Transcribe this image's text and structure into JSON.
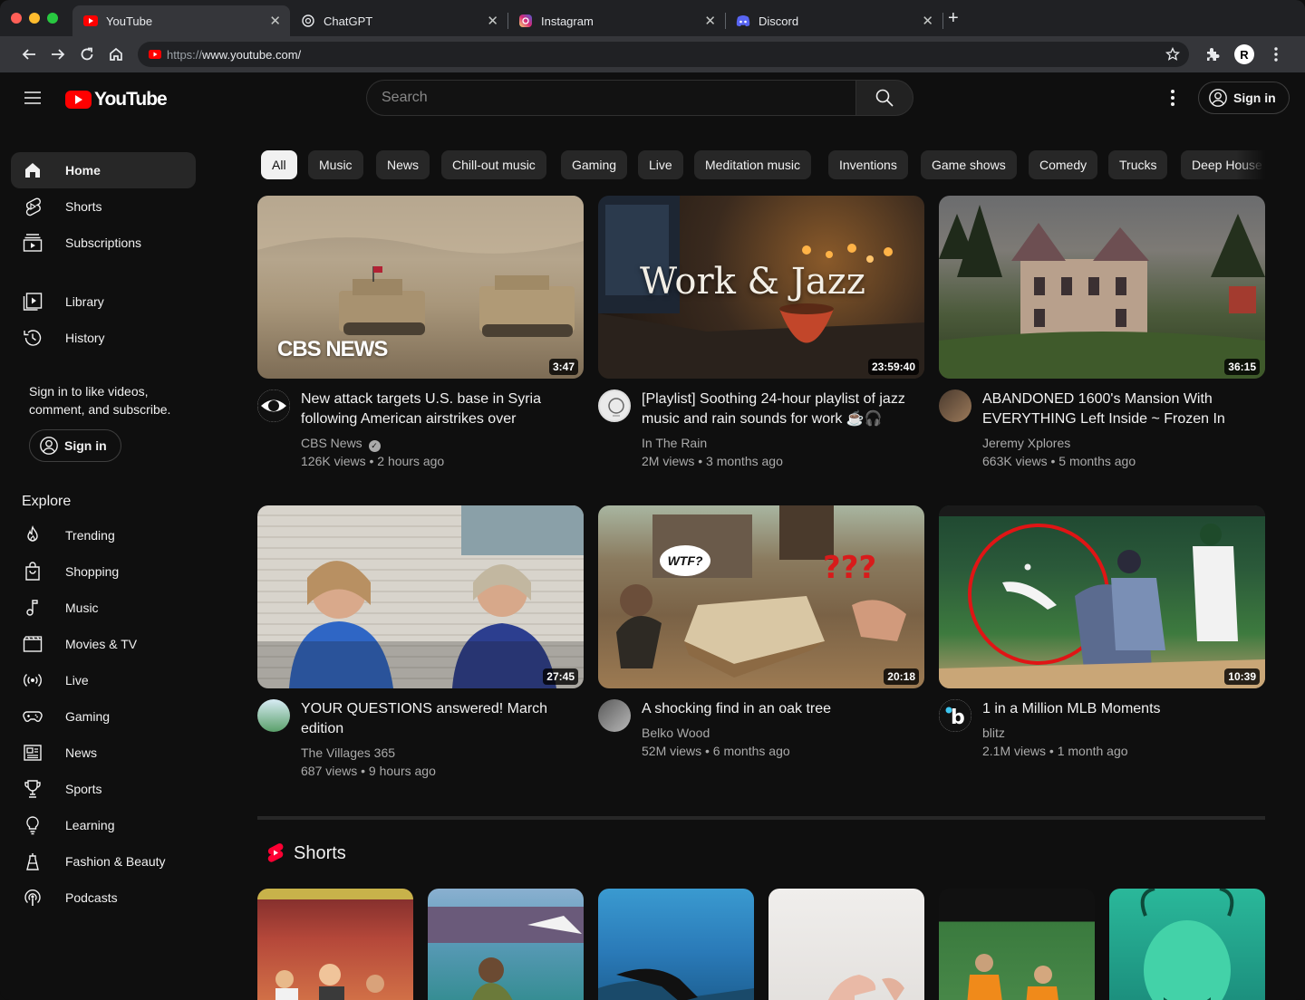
{
  "browser": {
    "tabs": [
      {
        "title": "YouTube",
        "icon": "youtube-icon",
        "active": true
      },
      {
        "title": "ChatGPT",
        "icon": "chatgpt-icon",
        "active": false
      },
      {
        "title": "Instagram",
        "icon": "instagram-icon",
        "active": false
      },
      {
        "title": "Discord",
        "icon": "discord-icon",
        "active": false
      }
    ],
    "url_protocol": "https://",
    "url_host": "www.youtube.com/",
    "profile_initial": "R"
  },
  "header": {
    "logo_text": "YouTube",
    "search_placeholder": "Search",
    "signin_label": "Sign in"
  },
  "sidebar": {
    "main": [
      {
        "label": "Home",
        "icon": "home-icon",
        "active": true
      },
      {
        "label": "Shorts",
        "icon": "shorts-icon"
      },
      {
        "label": "Subscriptions",
        "icon": "subscriptions-icon"
      }
    ],
    "library": [
      {
        "label": "Library",
        "icon": "library-icon"
      },
      {
        "label": "History",
        "icon": "history-icon"
      }
    ],
    "signin_message": "Sign in to like videos, comment, and subscribe.",
    "signin_label": "Sign in",
    "explore_title": "Explore",
    "explore": [
      {
        "label": "Trending",
        "icon": "trending-icon"
      },
      {
        "label": "Shopping",
        "icon": "shopping-icon"
      },
      {
        "label": "Music",
        "icon": "music-icon"
      },
      {
        "label": "Movies & TV",
        "icon": "movies-icon"
      },
      {
        "label": "Live",
        "icon": "live-icon"
      },
      {
        "label": "Gaming",
        "icon": "gaming-icon"
      },
      {
        "label": "News",
        "icon": "news-icon"
      },
      {
        "label": "Sports",
        "icon": "sports-icon"
      },
      {
        "label": "Learning",
        "icon": "learning-icon"
      },
      {
        "label": "Fashion & Beauty",
        "icon": "fashion-icon"
      },
      {
        "label": "Podcasts",
        "icon": "podcasts-icon"
      }
    ]
  },
  "chips": [
    "All",
    "Music",
    "News",
    "Chill-out music",
    "Gaming",
    "Live",
    "Meditation music",
    "Inventions",
    "Game shows",
    "Comedy",
    "Trucks",
    "Deep House"
  ],
  "videos": [
    {
      "title": "New attack targets U.S. base in Syria following American airstrikes over",
      "channel": "CBS News",
      "verified": true,
      "meta": "126K views • 2 hours ago",
      "duration": "3:47",
      "thumb_text": "CBS NEWS"
    },
    {
      "title": "[Playlist] Soothing 24-hour playlist of jazz music and rain sounds for work ☕🎧",
      "channel": "In The Rain",
      "verified": false,
      "meta": "2M views • 3 months ago",
      "duration": "23:59:40",
      "thumb_text": "Work & Jazz"
    },
    {
      "title": "ABANDONED 1600's Mansion With EVERYTHING Left Inside ~ Frozen In",
      "channel": "Jeremy Xplores",
      "verified": false,
      "meta": "663K views • 5 months ago",
      "duration": "36:15"
    },
    {
      "title": "YOUR QUESTIONS answered! March edition",
      "channel": "The Villages 365",
      "verified": false,
      "meta": "687 views • 9 hours ago",
      "duration": "27:45"
    },
    {
      "title": "A shocking find in an oak tree",
      "channel": "Belko Wood",
      "verified": false,
      "meta": "52M views • 6 months ago",
      "duration": "20:18",
      "thumb_text": "WTF?"
    },
    {
      "title": "1 in a Million MLB Moments",
      "channel": "blitz",
      "verified": false,
      "meta": "2.1M views • 1 month ago",
      "duration": "10:39"
    }
  ],
  "shorts_title": "Shorts"
}
